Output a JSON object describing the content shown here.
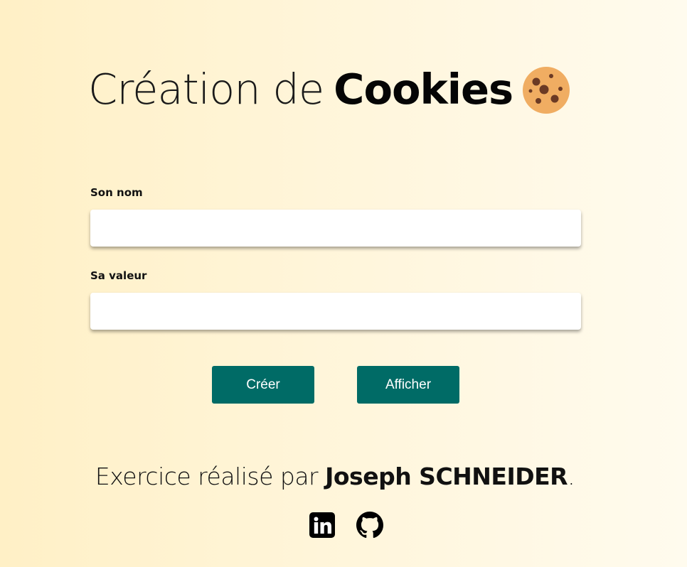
{
  "header": {
    "title_light": "Création de",
    "title_bold": "Cookies",
    "icon": "cookie-icon"
  },
  "form": {
    "name_field": {
      "label": "Son nom",
      "value": "",
      "placeholder": ""
    },
    "value_field": {
      "label": "Sa valeur",
      "value": "",
      "placeholder": ""
    }
  },
  "actions": {
    "create_label": "Créer",
    "show_label": "Afficher"
  },
  "footer": {
    "credit_prefix": "Exercice réalisé par",
    "author": "Joseph SCHNEIDER",
    "credit_suffix": ".",
    "social": [
      {
        "icon": "linkedin-icon"
      },
      {
        "icon": "github-icon"
      }
    ]
  },
  "colors": {
    "button": "#006b66",
    "button_text": "#ffffff",
    "background_start": "#fff0c6",
    "background_end": "#fffbee",
    "cookie": "#f0ad62",
    "cookie_chips": "#6b3a24"
  }
}
